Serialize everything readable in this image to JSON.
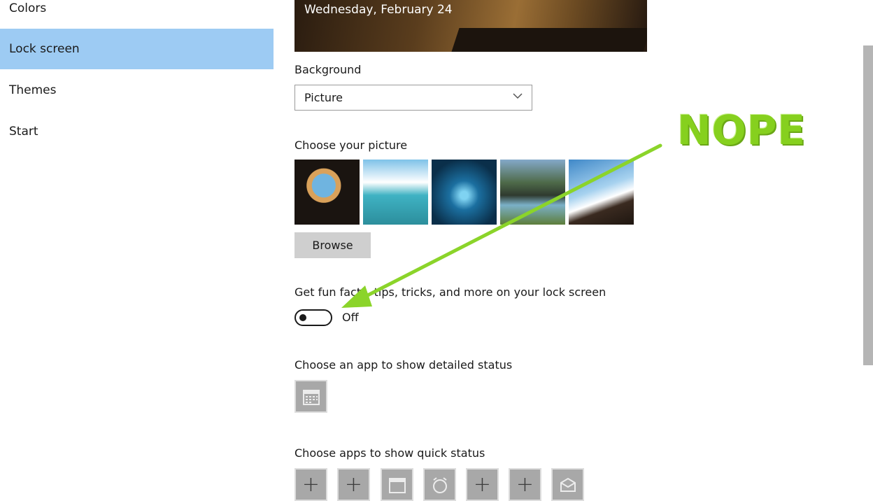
{
  "sidebar": {
    "items": [
      {
        "label": "Colors"
      },
      {
        "label": "Lock screen"
      },
      {
        "label": "Themes"
      },
      {
        "label": "Start"
      }
    ]
  },
  "preview": {
    "date": "Wednesday, February 24"
  },
  "background": {
    "label": "Background",
    "dropdown_value": "Picture"
  },
  "picture": {
    "label": "Choose your picture",
    "browse_label": "Browse"
  },
  "fun_facts": {
    "label": "Get fun facts, tips, tricks, and more on your lock screen",
    "toggle_state": "Off"
  },
  "detailed_status": {
    "label": "Choose an app to show detailed status"
  },
  "quick_status": {
    "label": "Choose apps to show quick status"
  },
  "annotation": {
    "text": "NOPE",
    "color": "#86d01e"
  },
  "colors": {
    "selected": "#9dcbf3",
    "button": "#cfcfcf"
  }
}
